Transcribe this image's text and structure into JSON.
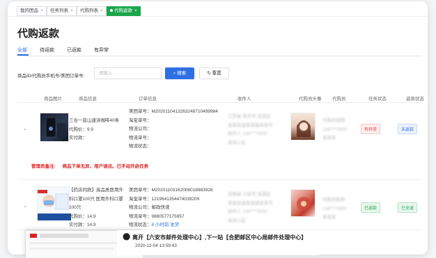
{
  "tabs": [
    {
      "label": "我的团品",
      "active": false
    },
    {
      "label": "任务列表",
      "active": false
    },
    {
      "label": "代购列表",
      "active": false
    },
    {
      "label": "代购返款",
      "active": true
    }
  ],
  "page_title": "代购返款",
  "subtabs": [
    "全部",
    "待返款",
    "已返款",
    "有异常"
  ],
  "search": {
    "label": "商品ID/代购员手机号/美团订单号:",
    "placeholder": "请输入",
    "search_label": "搜索",
    "reset_label": "重置"
  },
  "columns": [
    "商品图片",
    "商品信息",
    "订单信息",
    "收件人",
    "代购员头像",
    "代购员",
    "任务状态",
    "返款状态"
  ],
  "rows": [
    {
      "product_title": "三合一蓝山速溶咖啡40条",
      "price": "代购价：9.9",
      "paid": "实付款：",
      "meituan": "美团单号：M2020110413263248710499984",
      "taobao": "淘宝单号：",
      "logistics_co": "物流公司：",
      "logistics_no": "物流单号：",
      "logistics_status": "物流状态：",
      "recipient": [
        "江苏省 南京市 玄武区",
        "某某街道某某路某某号",
        "收件人 138****0000",
        "某某小区"
      ],
      "buyer": [
        "代购员昵称",
        "138****0000",
        "某某某"
      ],
      "task_status": "有异常",
      "refund_status": "未返款"
    },
    {
      "product_title": "【药店同款】高品质医用外科口罩100只 医用外科口罩100只",
      "price": "代购价：14.9",
      "paid": "实付款：14.9",
      "meituan": "美团单号：M2020110316200601898392​6",
      "taobao": "淘宝单号：1219641354474039209",
      "logistics_co": "物流公司：邮政快递",
      "logistics_no": "物流单号：9880577175957",
      "logistics_status_label": "物流状态：",
      "logistics_status_value": "8 小时前 发货",
      "recipient": [
        "安徽省 六安市 某某区",
        "某某街道某某路某某号",
        "收件人 139****0000",
        "某某小区"
      ],
      "buyer": [
        "代购员昵称",
        "139****0000",
        "某某某"
      ],
      "task_status": "已返款",
      "refund_status": "已全返"
    }
  ],
  "remark": {
    "label": "管理员备注:",
    "text": "商品下单无异，用户误点。已手动开启任务"
  },
  "tracking": {
    "text": "离开【六安市邮件处理中心】,下一站【合肥邮区中心局邮件处理中心】",
    "time": "2020-11-04 13:59:43"
  },
  "colors": {
    "accent": "#2f6fe4",
    "active_tab": "#1aa54b",
    "danger": "#e02020"
  }
}
